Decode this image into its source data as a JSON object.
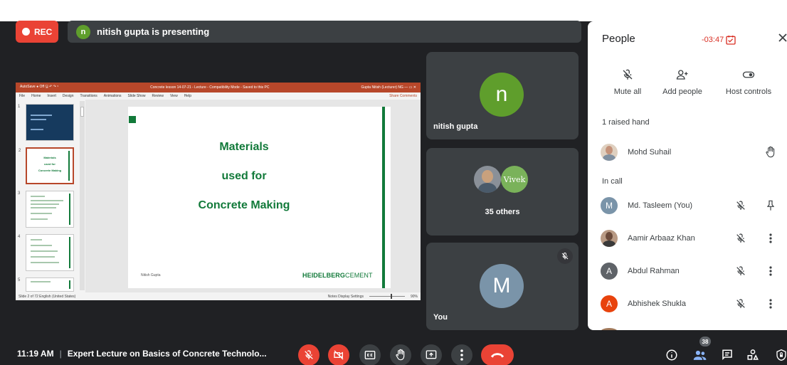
{
  "recording": {
    "label": "REC"
  },
  "presenter_bar": {
    "avatar_letter": "n",
    "text": "nitish gupta is presenting"
  },
  "presentation": {
    "title_bar_left": "AutoSave ● Off  🖫  ↶  ↷  ▾",
    "title_bar_center": "Concrete lesson 14-07-21 - Lecture - Compatibility Mode - Saved to this PC",
    "title_bar_right": "Gupta Nitish (Lecturer) NG  —  ▭  ✕",
    "menu": [
      "File",
      "Home",
      "Insert",
      "Design",
      "Transitions",
      "Animations",
      "Slide Show",
      "Review",
      "View",
      "Help"
    ],
    "menu_right": "Share   Comments",
    "thumb_numbers": [
      "1",
      "2",
      "3",
      "4",
      "5"
    ],
    "thumb2_lines": [
      "Materials",
      "used for",
      "Concrete Making"
    ],
    "slide": {
      "lines": [
        "Materials",
        "used for",
        "Concrete Making"
      ],
      "author": "Nitish Gupta",
      "logo_a": "HEIDELBERG",
      "logo_b": "CEMENT"
    },
    "status_left": "Slide 2 of 72    English (United States)",
    "status_right": "Notes   Display Settings",
    "zoom": "90%"
  },
  "tiles": {
    "presenter": {
      "letter": "n",
      "name": "nitish gupta",
      "avatar_color": "#5f9e2c"
    },
    "others": {
      "second_label": "Vivek",
      "label": "35 others"
    },
    "you": {
      "letter": "M",
      "name": "You",
      "avatar_color": "#7a94a9"
    }
  },
  "people_panel": {
    "title": "People",
    "timer": "-03:47",
    "host_actions": [
      {
        "label": "Mute all",
        "icon": "mic-off-icon"
      },
      {
        "label": "Add people",
        "icon": "add-person-icon"
      },
      {
        "label": "Host controls",
        "icon": "toggle-icon"
      }
    ],
    "raised_hand_header": "1 raised hand",
    "raised": {
      "name": "Mohd Suhail"
    },
    "in_call_header": "In call",
    "participants": [
      {
        "name": "Md. Tasleem (You)",
        "letter": "M",
        "color": "#7a94a9"
      },
      {
        "name": "Aamir Arbaaz Khan",
        "letter": "",
        "color": "#b89a84"
      },
      {
        "name": "Abdul Rahman",
        "letter": "A",
        "color": "#5f6368"
      },
      {
        "name": "Abhishek Shukla",
        "letter": "A",
        "color": "#e8430d"
      }
    ]
  },
  "bottom_bar": {
    "time": "11:19 AM",
    "separator": "|",
    "meeting_title": "Expert Lecture on Basics of Concrete Technolo...",
    "people_count": "38"
  }
}
